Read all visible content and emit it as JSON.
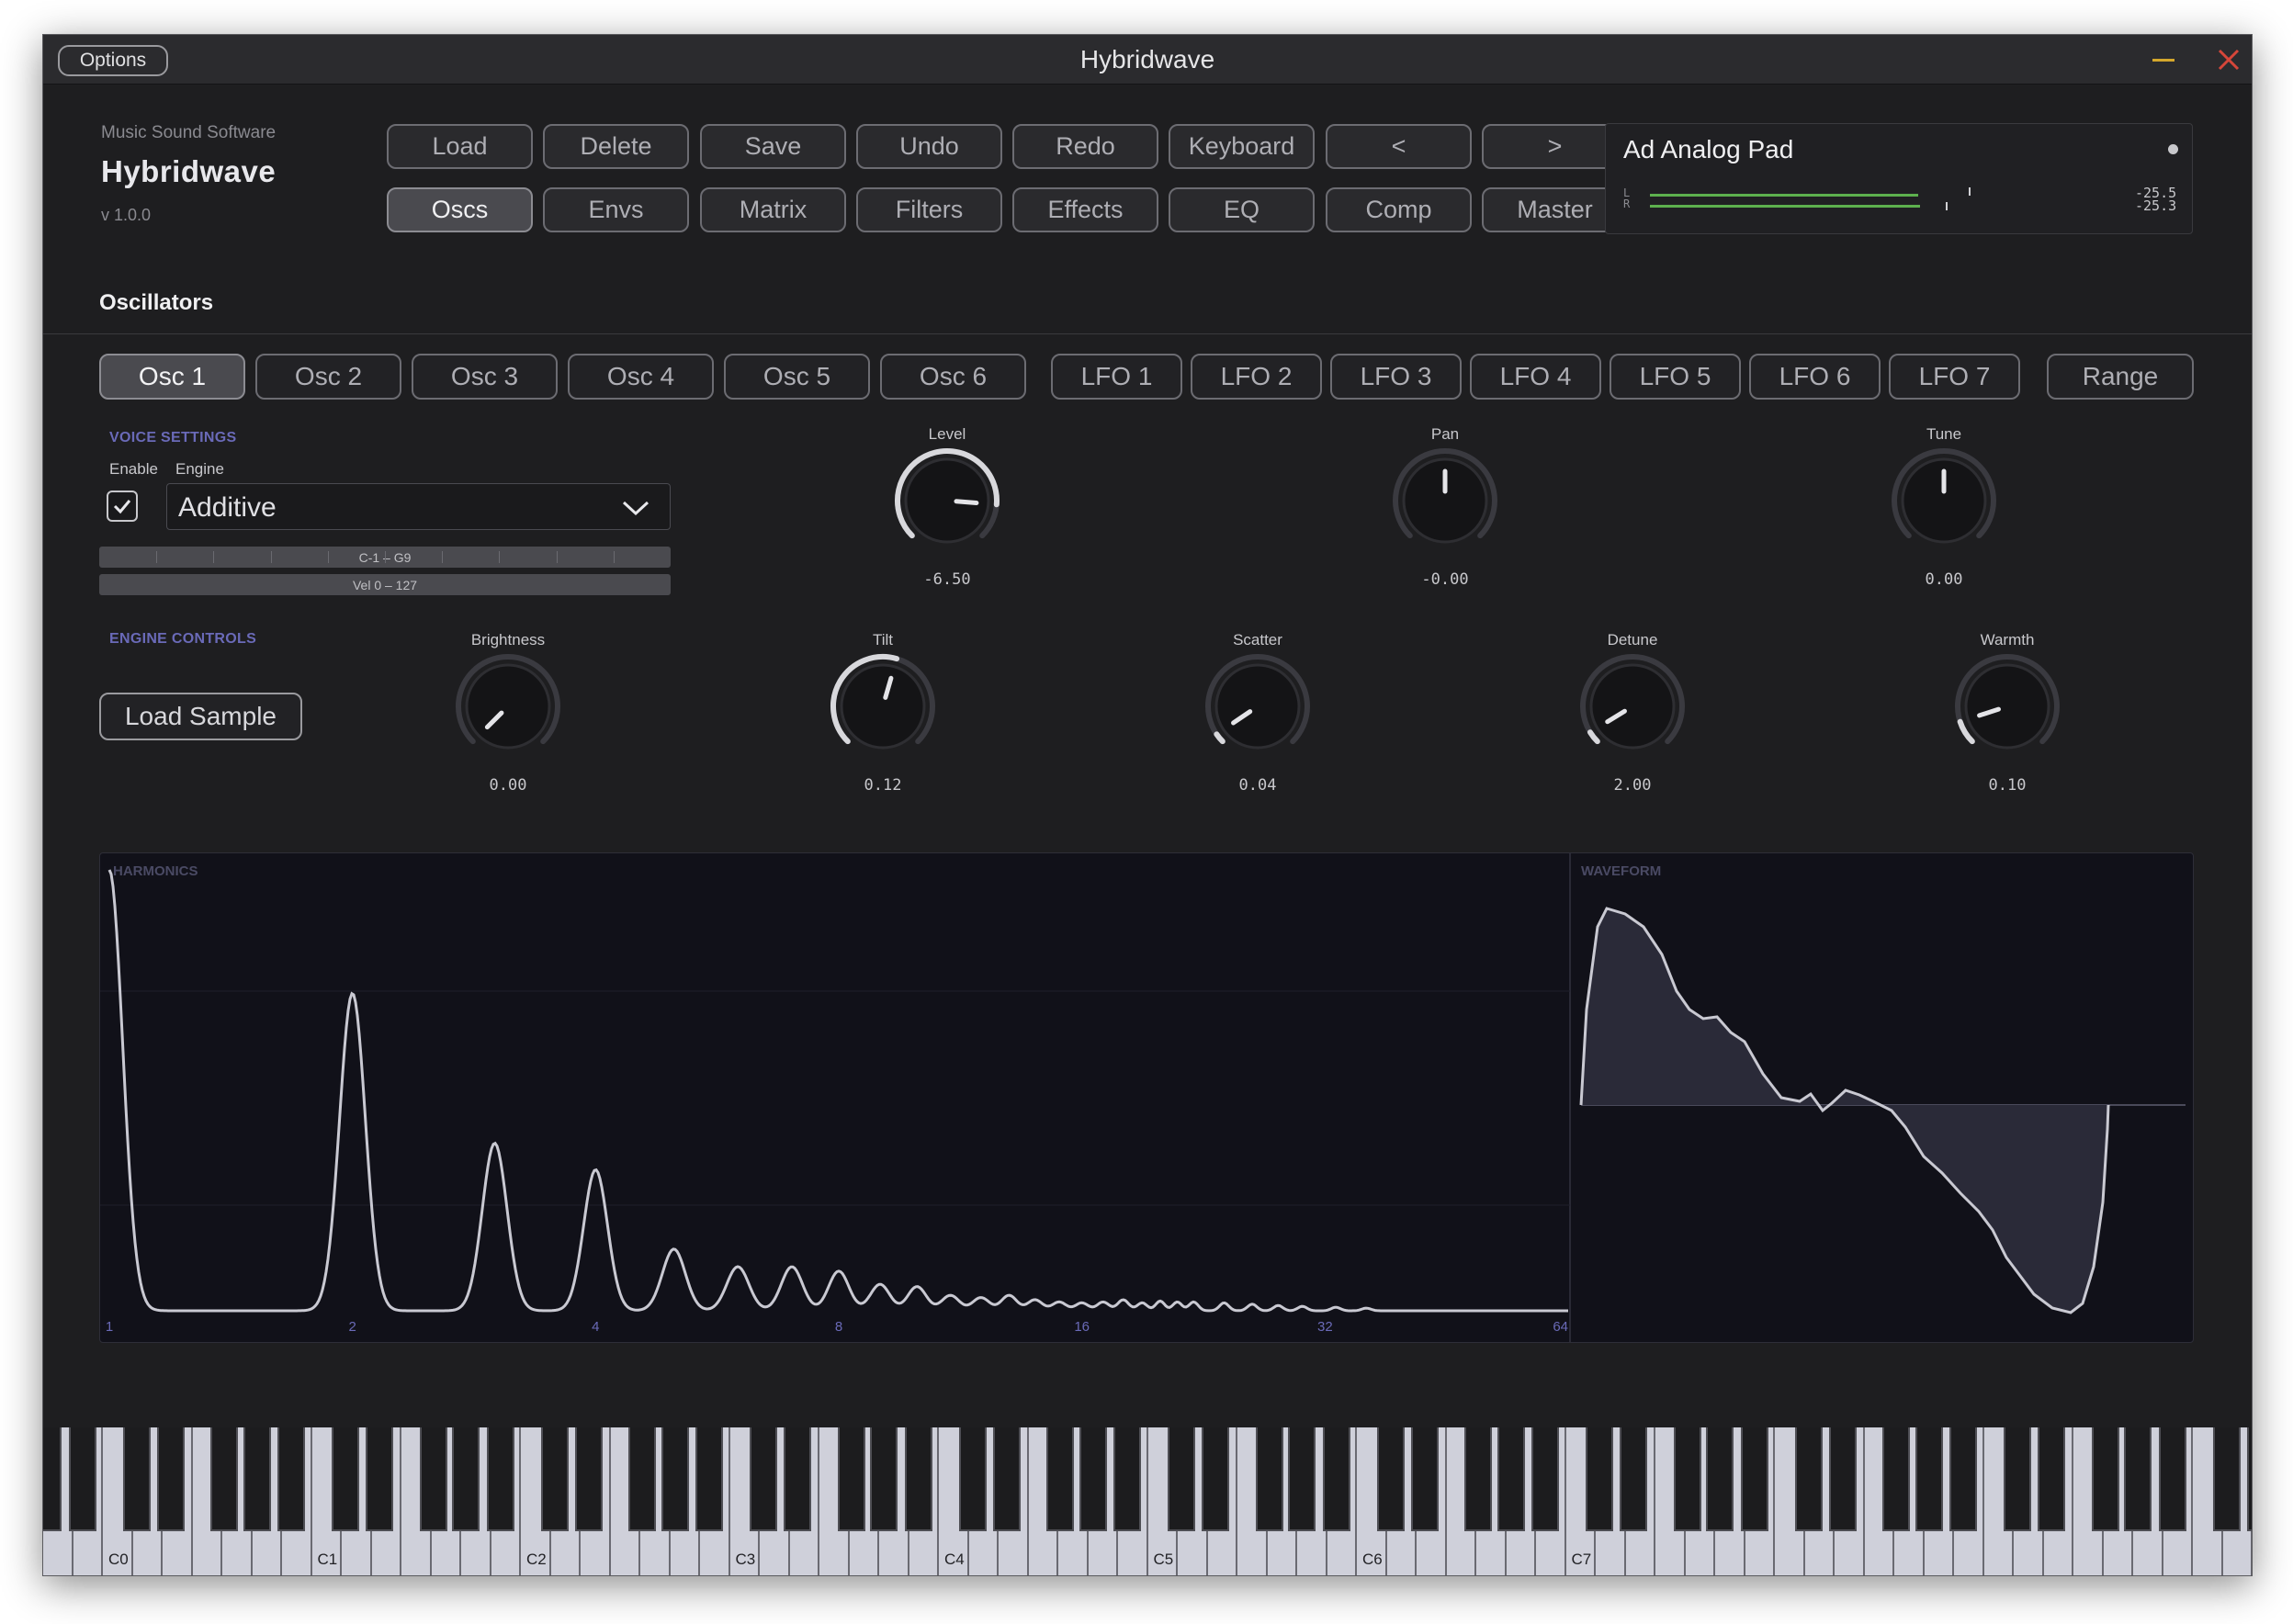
{
  "window": {
    "title": "Hybridwave",
    "options_label": "Options"
  },
  "brand": {
    "company": "Music Sound Software",
    "name": "Hybridwave",
    "version": "v 1.0.0"
  },
  "toolbar": {
    "row1": [
      "Load",
      "Delete",
      "Save",
      "Undo",
      "Redo",
      "Keyboard",
      "<",
      ">"
    ],
    "row2": [
      "Oscs",
      "Envs",
      "Matrix",
      "Filters",
      "Effects",
      "EQ",
      "Comp",
      "Master"
    ],
    "active": "Oscs"
  },
  "preset": {
    "name": "Ad Analog Pad",
    "meter": {
      "left_label": "L",
      "right_label": "R",
      "left_value": "-25.5",
      "right_value": "-25.3",
      "left_level": 0.86,
      "right_level": 0.86
    }
  },
  "section": {
    "title": "Oscillators"
  },
  "osc_tabs": [
    "Osc 1",
    "Osc 2",
    "Osc 3",
    "Osc 4",
    "Osc 5",
    "Osc 6"
  ],
  "lfo_tabs": [
    "LFO 1",
    "LFO 2",
    "LFO 3",
    "LFO 4",
    "LFO 5",
    "LFO 6",
    "LFO 7"
  ],
  "range_tab": "Range",
  "active_tab": "Osc 1",
  "voice": {
    "header": "VOICE SETTINGS",
    "enable_label": "Enable",
    "engine_label": "Engine",
    "enabled": true,
    "engine": "Additive",
    "key_range": "C-1 – G9",
    "vel_range": "Vel 0 – 127"
  },
  "engine_controls": {
    "header": "ENGINE CONTROLS",
    "load_sample": "Load Sample"
  },
  "knobs_top": [
    {
      "label": "Level",
      "value": "-6.50",
      "pos": 0.85,
      "ring": true
    },
    {
      "label": "Pan",
      "value": "-0.00",
      "pos": 0.5,
      "ring": false
    },
    {
      "label": "Tune",
      "value": "0.00",
      "pos": 0.5,
      "ring": false
    }
  ],
  "knobs_engine": [
    {
      "label": "Brightness",
      "value": "0.00",
      "pos": 0.0
    },
    {
      "label": "Tilt",
      "value": "0.12",
      "pos": 0.56
    },
    {
      "label": "Scatter",
      "value": "0.04",
      "pos": 0.04
    },
    {
      "label": "Detune",
      "value": "2.00",
      "pos": 0.05
    },
    {
      "label": "Warmth",
      "value": "0.10",
      "pos": 0.1
    }
  ],
  "display": {
    "harmonics_label": "HARMONICS",
    "waveform_label": "WAVEFORM",
    "harmonic_ticks": [
      "1",
      "2",
      "4",
      "8",
      "16",
      "32",
      "64"
    ]
  },
  "keyboard": {
    "labels": [
      "C0",
      "C1",
      "C2",
      "C3",
      "C4",
      "C5",
      "C6",
      "C7"
    ]
  },
  "colors": {
    "accent_header": "#6a6ab8",
    "meter_green": "#5db04e",
    "close_red": "#d6463a",
    "minimize_yellow": "#d4a72c"
  }
}
